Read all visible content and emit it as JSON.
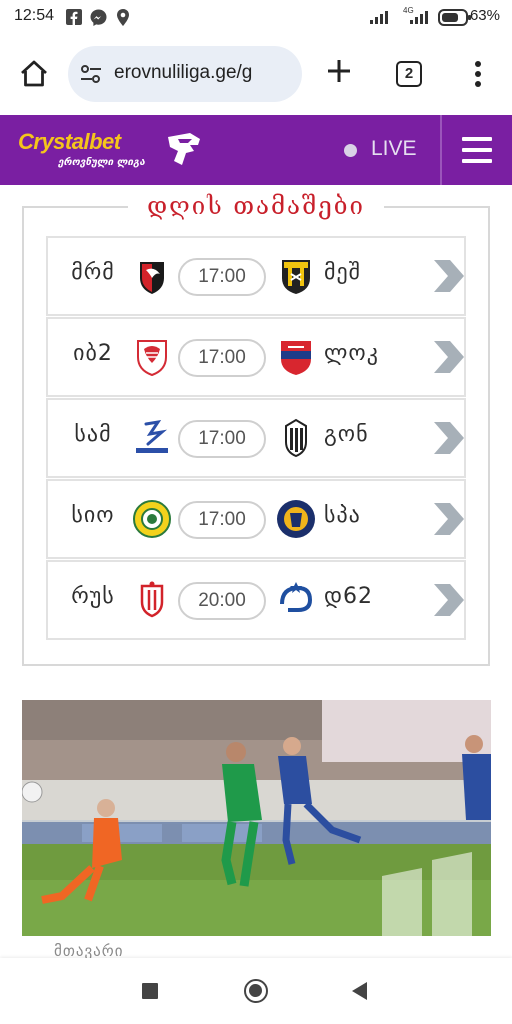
{
  "status_bar": {
    "time": "12:54",
    "network": "4G",
    "battery": "63%"
  },
  "browser": {
    "url": "erovnuliliga.ge/g",
    "tab_count": "2"
  },
  "site": {
    "brand": "Crystalbet",
    "brand_sub": "ეროვნული ლიგა",
    "live_label": "LIVE",
    "purple": "#7a1fa2",
    "gold": "#f5c51b"
  },
  "matches_section": {
    "title": "დღის თამაშები",
    "matches": [
      {
        "home": "მრმ",
        "time": "17:00",
        "away": "მეშ",
        "home_icon": "merani-martvili-crest-icon",
        "away_icon": "meshakhte-crest-icon"
      },
      {
        "home": "იბ2",
        "time": "17:00",
        "away": "ლოკ",
        "home_icon": "iberia-crest-icon",
        "away_icon": "lokomotivi-crest-icon"
      },
      {
        "home": "სამ",
        "time": "17:00",
        "away": "გონ",
        "home_icon": "samtredia-crest-icon",
        "away_icon": "gonio-crest-icon"
      },
      {
        "home": "სიო",
        "time": "17:00",
        "away": "სპა",
        "home_icon": "sioni-crest-icon",
        "away_icon": "spaeri-crest-icon"
      },
      {
        "home": "რუს",
        "time": "20:00",
        "away": "დ62",
        "home_icon": "rustavi-crest-icon",
        "away_icon": "dinamo-tbilisi-crest-icon"
      }
    ]
  },
  "news": {
    "caption": "მთავარი"
  }
}
